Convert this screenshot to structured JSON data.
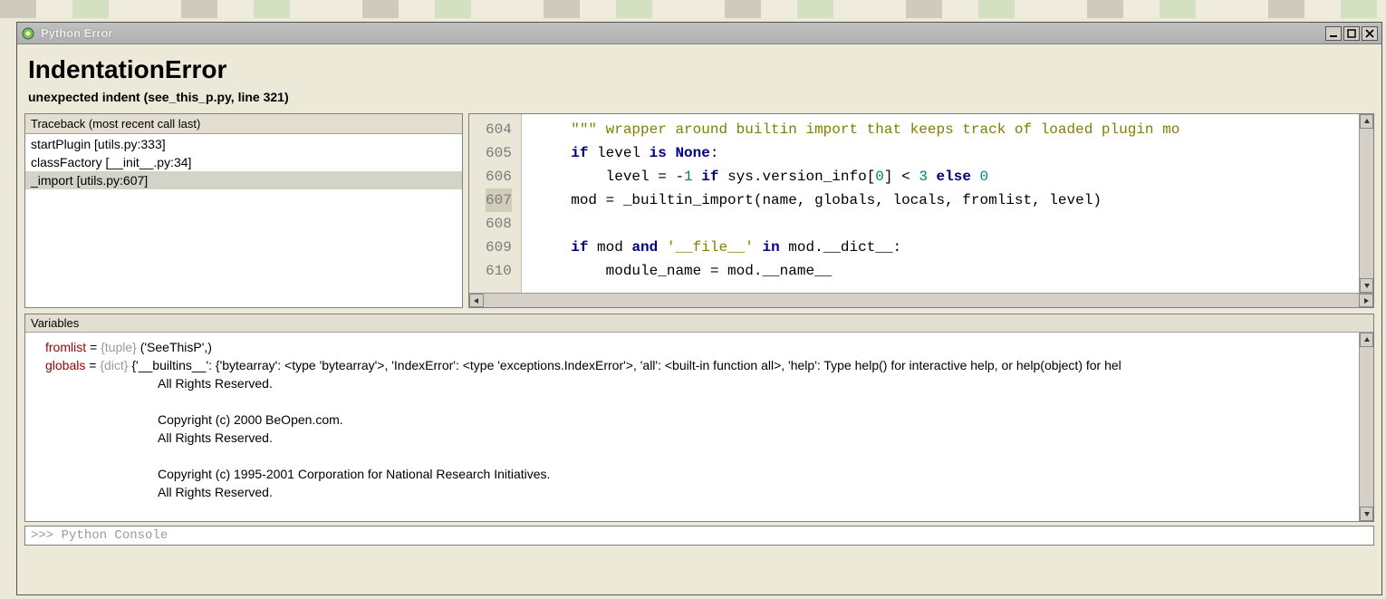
{
  "window": {
    "title": "Python Error"
  },
  "error": {
    "title": "IndentationError",
    "message": "unexpected indent (see_this_p.py, line 321)"
  },
  "traceback": {
    "header": "Traceback (most recent call last)",
    "rows": [
      {
        "text": "startPlugin [utils.py:333]",
        "selected": false
      },
      {
        "text": "classFactory [__init__.py:34]",
        "selected": false
      },
      {
        "text": "_import [utils.py:607]",
        "selected": true
      }
    ]
  },
  "code": {
    "lines": [
      {
        "n": 604,
        "hl": false,
        "html": "    <span class=\"str\">&quot;&quot;&quot; wrapper around builtin import that keeps track of loaded plugin mo</span>"
      },
      {
        "n": 605,
        "hl": false,
        "html": "    <span class=\"kw\">if</span> level <span class=\"kw\">is</span> <span class=\"kw\">None</span>:"
      },
      {
        "n": 606,
        "hl": false,
        "html": "        level = -<span class=\"num\">1</span> <span class=\"kw\">if</span> sys.version_info[<span class=\"num\">0</span>] &lt; <span class=\"num\">3</span> <span class=\"kw\">else</span> <span class=\"num\">0</span>"
      },
      {
        "n": 607,
        "hl": true,
        "html": "    mod = _builtin_import(name, globals, locals, fromlist, level)"
      },
      {
        "n": 608,
        "hl": false,
        "html": ""
      },
      {
        "n": 609,
        "hl": false,
        "html": "    <span class=\"kw\">if</span> mod <span class=\"kw\">and</span> <span class=\"str\">'__file__'</span> <span class=\"kw\">in</span> mod.__dict__:"
      },
      {
        "n": 610,
        "hl": false,
        "html": "        module_name = mod.__name__"
      }
    ]
  },
  "variables": {
    "header": "Variables",
    "rows": [
      {
        "name": "fromlist",
        "type": "{tuple}",
        "value": "('SeeThisP',)",
        "extra_lines": []
      },
      {
        "name": "globals",
        "type": "{dict}",
        "value": "{'__builtins__': {'bytearray': <type 'bytearray'>, 'IndexError': <type 'exceptions.IndexError'>, 'all': <built-in function all>, 'help': Type help() for interactive help, or help(object) for hel",
        "extra_lines": [
          "All Rights Reserved.",
          "",
          "Copyright (c) 2000 BeOpen.com.",
          "All Rights Reserved.",
          "",
          "Copyright (c) 1995-2001 Corporation for National Research Initiatives.",
          "All Rights Reserved."
        ]
      }
    ]
  },
  "console": {
    "prompt": ">>> ",
    "placeholder": "Python Console"
  }
}
